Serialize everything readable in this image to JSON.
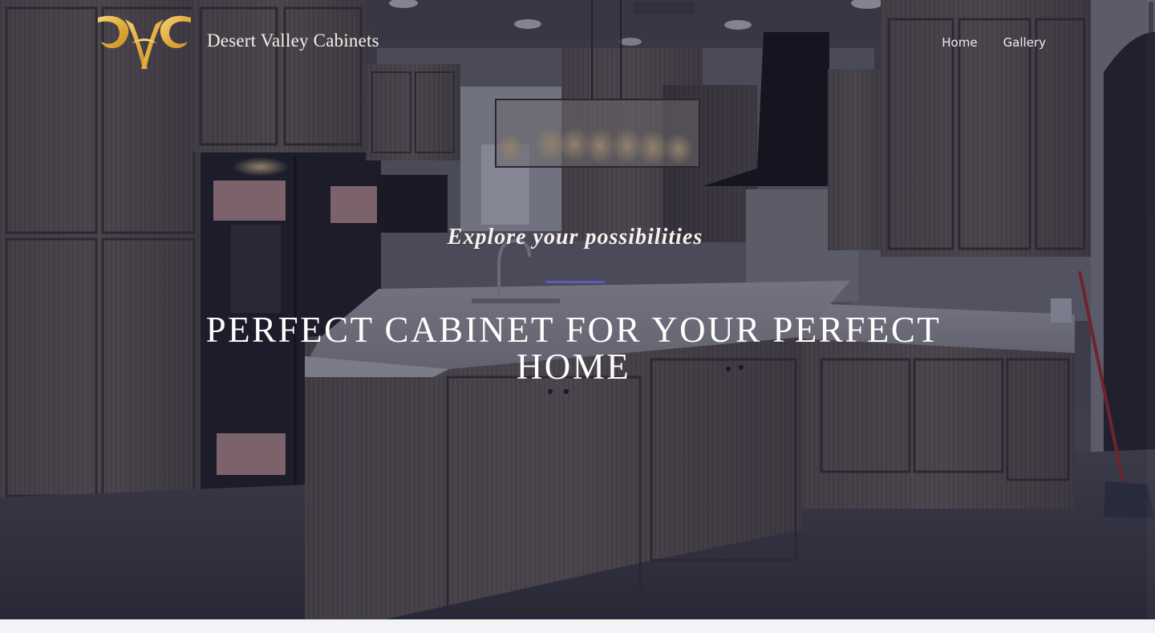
{
  "header": {
    "brand_name": "Desert Valley Cabinets",
    "logo_icon": "dvc-monogram-logo",
    "nav": [
      {
        "label": "Home"
      },
      {
        "label": "Gallery"
      }
    ]
  },
  "hero": {
    "tagline": "Explore your possibilities",
    "headline": "PERFECT CABINET FOR YOUR PERFECT HOME",
    "background": "kitchen-photo"
  },
  "colors": {
    "overlay": "#18162c",
    "logo_gold": "#e9b84a",
    "accent_rule": "#5a5fc9",
    "text": "#ffffff"
  }
}
